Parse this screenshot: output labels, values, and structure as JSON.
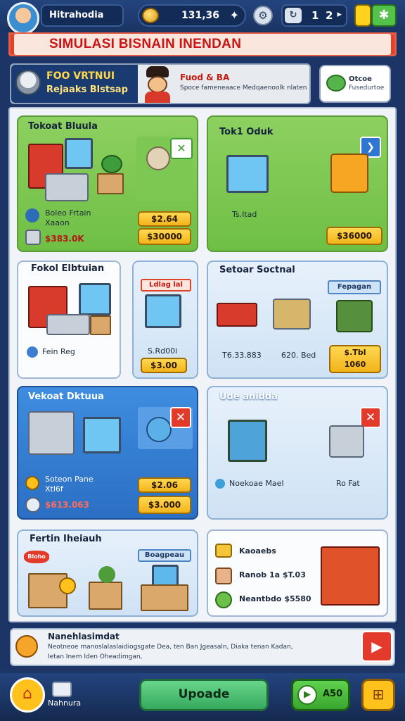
{
  "header": {
    "player_name": "Hitrahodia",
    "coins": "131,36",
    "level_a": "1",
    "level_b": "2"
  },
  "title": "SIMULASI BISNAIN INENDAN",
  "promo": {
    "left_line1": "FOO VRTNUI",
    "left_line2": "Rejaaks Blstsap",
    "middle_title": "Fuod & BA",
    "middle_text": "Spoce fameneaace Medqaenoolk nlaten",
    "right_title": "Otcoe",
    "right_text": "Fusedurtoe"
  },
  "cards": {
    "c1": {
      "title": "Tokoat Bluula",
      "label": "Boleo Frtain",
      "label2": "Xaaon",
      "earnings": "$383.0K",
      "price1": "$2.64",
      "price2": "$30000"
    },
    "c2": {
      "title": "Tok1 Oduk",
      "label": "Ts.Itad",
      "price": "$36000"
    },
    "c3": {
      "title": "Fokol Elbtuian",
      "label": "Fein Reg"
    },
    "c4": {
      "tag": "Ldlag lal",
      "label": "S.Rd00i",
      "price": "$3.00"
    },
    "c5": {
      "title": "Setoar Soctnal",
      "label1": "T6.33.883",
      "label2": "620. Bed",
      "tag": "Fepagan",
      "small_price": "$.Tbl",
      "price": "1060"
    },
    "c6": {
      "title": "Vekoat Dktuua",
      "label": "Soteon Pane",
      "label2": "Xtl6f",
      "earnings": "$613.063",
      "price1": "$2.06",
      "price2": "$3.000"
    },
    "c7": {
      "title": "Ude anidda",
      "label": "Noekoae Mael",
      "label2": "Ro Fat"
    },
    "c8": {
      "title": "Fertin Iheiauh",
      "tag": "Boagpeau",
      "badge": "Bloho"
    },
    "c9": {
      "line1": "Kaoaebs",
      "line2": "Ranob 1a $T.03",
      "line3": "Neantbdo $5580"
    }
  },
  "news": {
    "title": "Nanehlasimdat",
    "text1": "Neotneoe manoslalaslaidiogsgate Dea, ten Ban Jgeasaln, Diaka tenan Kadan,",
    "text2": "Ietan Inem Iden Oheadimgan,"
  },
  "footer": {
    "left_label": "Nahnura",
    "upgrade_label": "Upoade",
    "ad_label": "A50"
  },
  "colors": {
    "background": "#1c3566",
    "title_red": "#e0432a",
    "price_yellow": "#ffd852",
    "card_green": "#8dd060",
    "card_blue": "#3e8de0"
  },
  "icons": [
    "coin-icon",
    "gear-icon",
    "level-icon",
    "close-icon",
    "chevron-icon",
    "play-icon",
    "home-icon",
    "ad-icon",
    "menu-icon"
  ]
}
